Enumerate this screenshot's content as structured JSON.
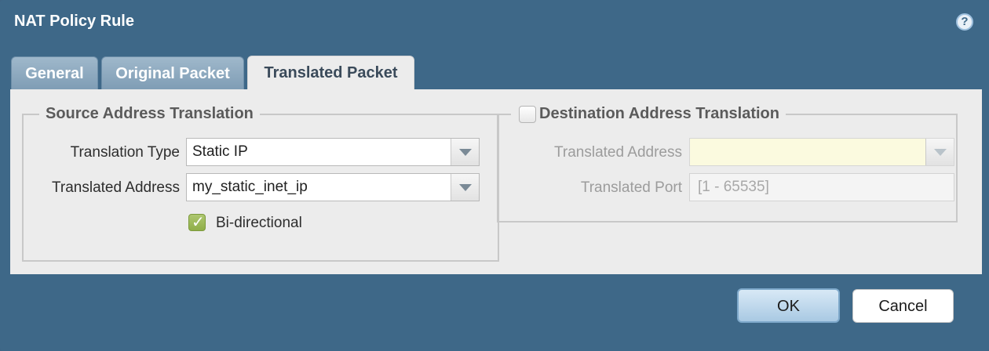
{
  "dialog": {
    "title": "NAT Policy Rule",
    "help_icon": "help-icon",
    "help_glyph": "?"
  },
  "tabs": [
    {
      "label": "General",
      "active": false
    },
    {
      "label": "Original Packet",
      "active": false
    },
    {
      "label": "Translated Packet",
      "active": true
    }
  ],
  "source_translation": {
    "legend": "Source Address Translation",
    "translation_type_label": "Translation Type",
    "translation_type_value": "Static IP",
    "translated_address_label": "Translated Address",
    "translated_address_value": "my_static_inet_ip",
    "bidirectional_label": "Bi-directional",
    "bidirectional_checked": true
  },
  "destination_translation": {
    "legend": "Destination Address Translation",
    "enabled": false,
    "translated_address_label": "Translated Address",
    "translated_address_value": "",
    "translated_port_label": "Translated Port",
    "translated_port_placeholder": "[1 - 65535]"
  },
  "footer": {
    "ok_label": "OK",
    "cancel_label": "Cancel"
  }
}
